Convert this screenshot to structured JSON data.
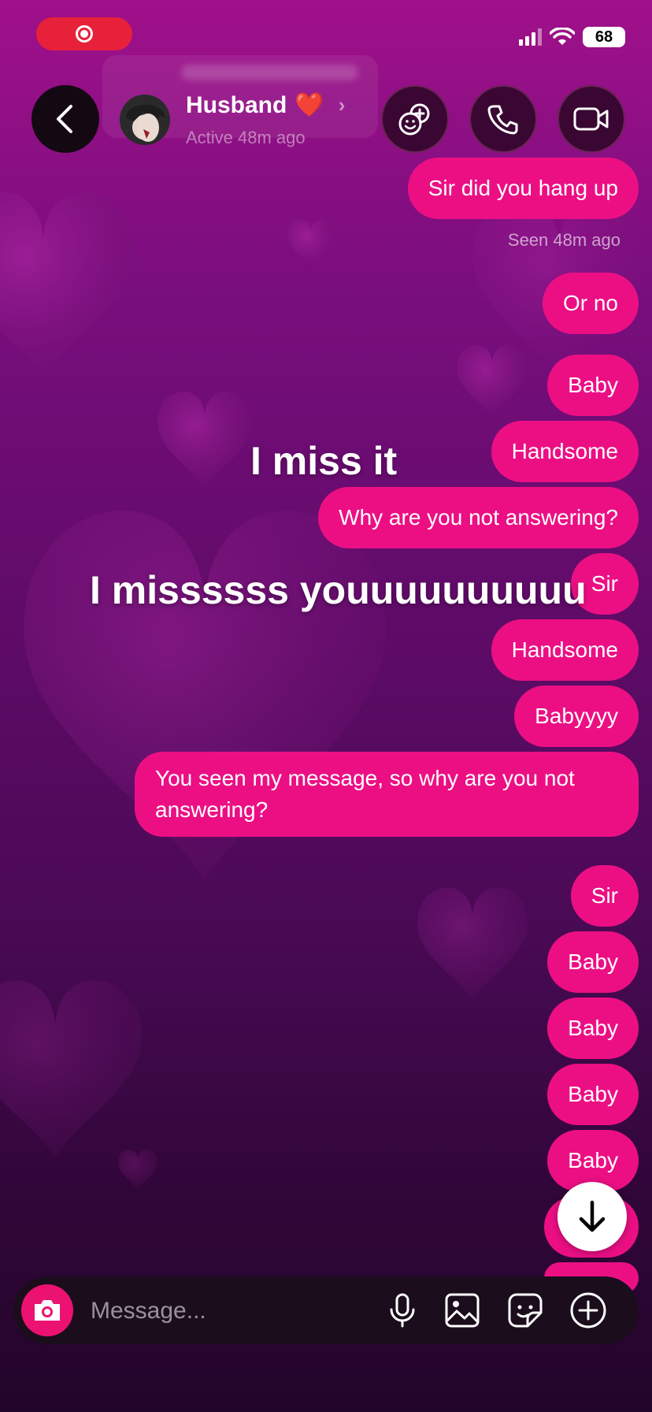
{
  "status_bar": {
    "battery": "68",
    "recording_icon": "screen-record-icon",
    "signal_icon": "cellular-signal-icon",
    "wifi_icon": "wifi-icon"
  },
  "header": {
    "contact_name": "Husband",
    "name_emoji": "❤️",
    "status": "Active 48m ago",
    "icons": [
      "back-icon",
      "add-people-icon",
      "phone-icon",
      "video-icon"
    ]
  },
  "messages": [
    {
      "text": "Sir did you hang up"
    },
    {
      "text": "Or no"
    },
    {
      "text": "Baby"
    },
    {
      "text": "Handsome"
    },
    {
      "text": "Why are you not answering?"
    },
    {
      "text": "Sir"
    },
    {
      "text": "Handsome"
    },
    {
      "text": "Babyyyy"
    },
    {
      "text": "You seen my message, so why are you not answering?"
    },
    {
      "text": "Sir"
    },
    {
      "text": "Baby"
    },
    {
      "text": "Baby"
    },
    {
      "text": "Baby"
    },
    {
      "text": "Baby"
    }
  ],
  "seen_label": "Seen 48m ago",
  "overlay": {
    "line1": "I miss it",
    "line2": "I missssss youuuuuuuuuu"
  },
  "composer": {
    "placeholder": "Message...",
    "icons": [
      "camera-icon",
      "microphone-icon",
      "gallery-icon",
      "sticker-icon",
      "plus-icon"
    ]
  },
  "colors": {
    "bubble": "#ec0f84",
    "background_top": "#a0108a",
    "background_bottom": "#22052a",
    "camera_button": "#ec1271"
  }
}
